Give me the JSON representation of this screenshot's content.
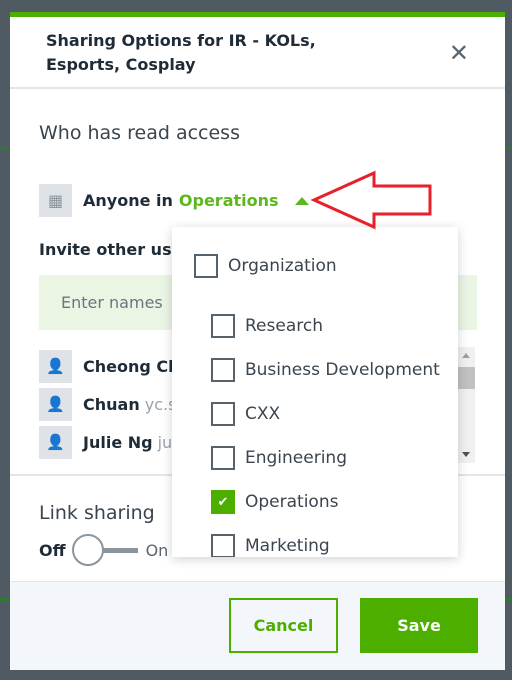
{
  "modal": {
    "title": "Sharing Options for IR - KOLs, Esports, Cosplay",
    "close_icon": "close-icon",
    "read_access_title": "Who has read access",
    "anyone_prefix": "Anyone in",
    "selected_group": "Operations",
    "invite_label": "Invite other us",
    "invite_placeholder": "Enter names",
    "users": [
      {
        "name": "Cheong Ch",
        "email": ""
      },
      {
        "name": "Chuan",
        "email": "yc.s"
      },
      {
        "name": "Julie Ng",
        "email": "ju"
      }
    ],
    "link_sharing_title": "Link sharing",
    "toggle_off": "Off",
    "toggle_on": "On",
    "link_sharing_enabled": false,
    "cancel_label": "Cancel",
    "save_label": "Save"
  },
  "dropdown": {
    "options": [
      {
        "label": "Organization",
        "checked": false
      },
      {
        "label": "Research",
        "checked": false
      },
      {
        "label": "Business Development",
        "checked": false
      },
      {
        "label": "CXX",
        "checked": false
      },
      {
        "label": "Engineering",
        "checked": false
      },
      {
        "label": "Operations",
        "checked": true
      },
      {
        "label": "Marketing",
        "checked": false
      }
    ]
  },
  "colors": {
    "accent": "#4caf00",
    "annotation_arrow": "#e8202a"
  }
}
